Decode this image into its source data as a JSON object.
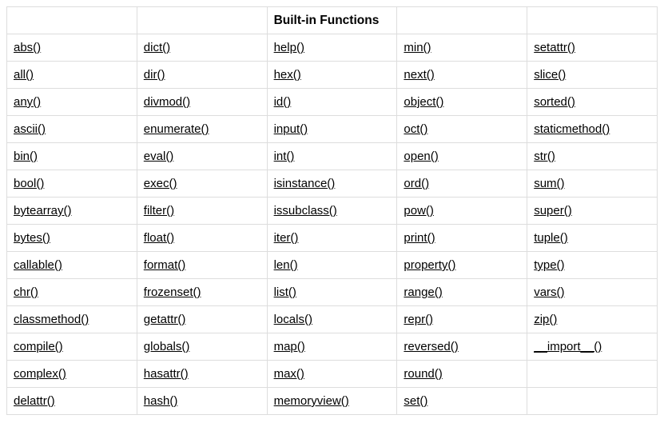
{
  "header": {
    "c0": "",
    "c1": "",
    "c2": "Built-in Functions",
    "c3": "",
    "c4": ""
  },
  "rows": [
    {
      "c0": "abs()",
      "c1": "dict()",
      "c2": "help()",
      "c3": "min()",
      "c4": "setattr()"
    },
    {
      "c0": "all()",
      "c1": "dir()",
      "c2": "hex()",
      "c3": "next()",
      "c4": "slice()"
    },
    {
      "c0": "any()",
      "c1": "divmod()",
      "c2": "id()",
      "c3": "object()",
      "c4": "sorted()"
    },
    {
      "c0": "ascii()",
      "c1": "enumerate()",
      "c2": "input()",
      "c3": "oct()",
      "c4": "staticmethod()"
    },
    {
      "c0": "bin()",
      "c1": "eval()",
      "c2": "int()",
      "c3": "open()",
      "c4": "str()"
    },
    {
      "c0": "bool()",
      "c1": "exec()",
      "c2": "isinstance()",
      "c3": "ord()",
      "c4": "sum()"
    },
    {
      "c0": "bytearray()",
      "c1": "filter()",
      "c2": "issubclass()",
      "c3": "pow()",
      "c4": "super()"
    },
    {
      "c0": "bytes()",
      "c1": "float()",
      "c2": "iter()",
      "c3": "print()",
      "c4": "tuple()"
    },
    {
      "c0": "callable()",
      "c1": "format()",
      "c2": "len()",
      "c3": "property()",
      "c4": "type()"
    },
    {
      "c0": "chr()",
      "c1": "frozenset()",
      "c2": "list()",
      "c3": "range()",
      "c4": "vars()"
    },
    {
      "c0": "classmethod()",
      "c1": "getattr()",
      "c2": "locals()",
      "c3": "repr()",
      "c4": "zip()"
    },
    {
      "c0": "compile()",
      "c1": "globals()",
      "c2": "map()",
      "c3": "reversed()",
      "c4": "__import__()"
    },
    {
      "c0": "complex()",
      "c1": "hasattr()",
      "c2": "max()",
      "c3": "round()",
      "c4": ""
    },
    {
      "c0": "delattr()",
      "c1": "hash()",
      "c2": "memoryview()",
      "c3": "set()",
      "c4": ""
    }
  ]
}
